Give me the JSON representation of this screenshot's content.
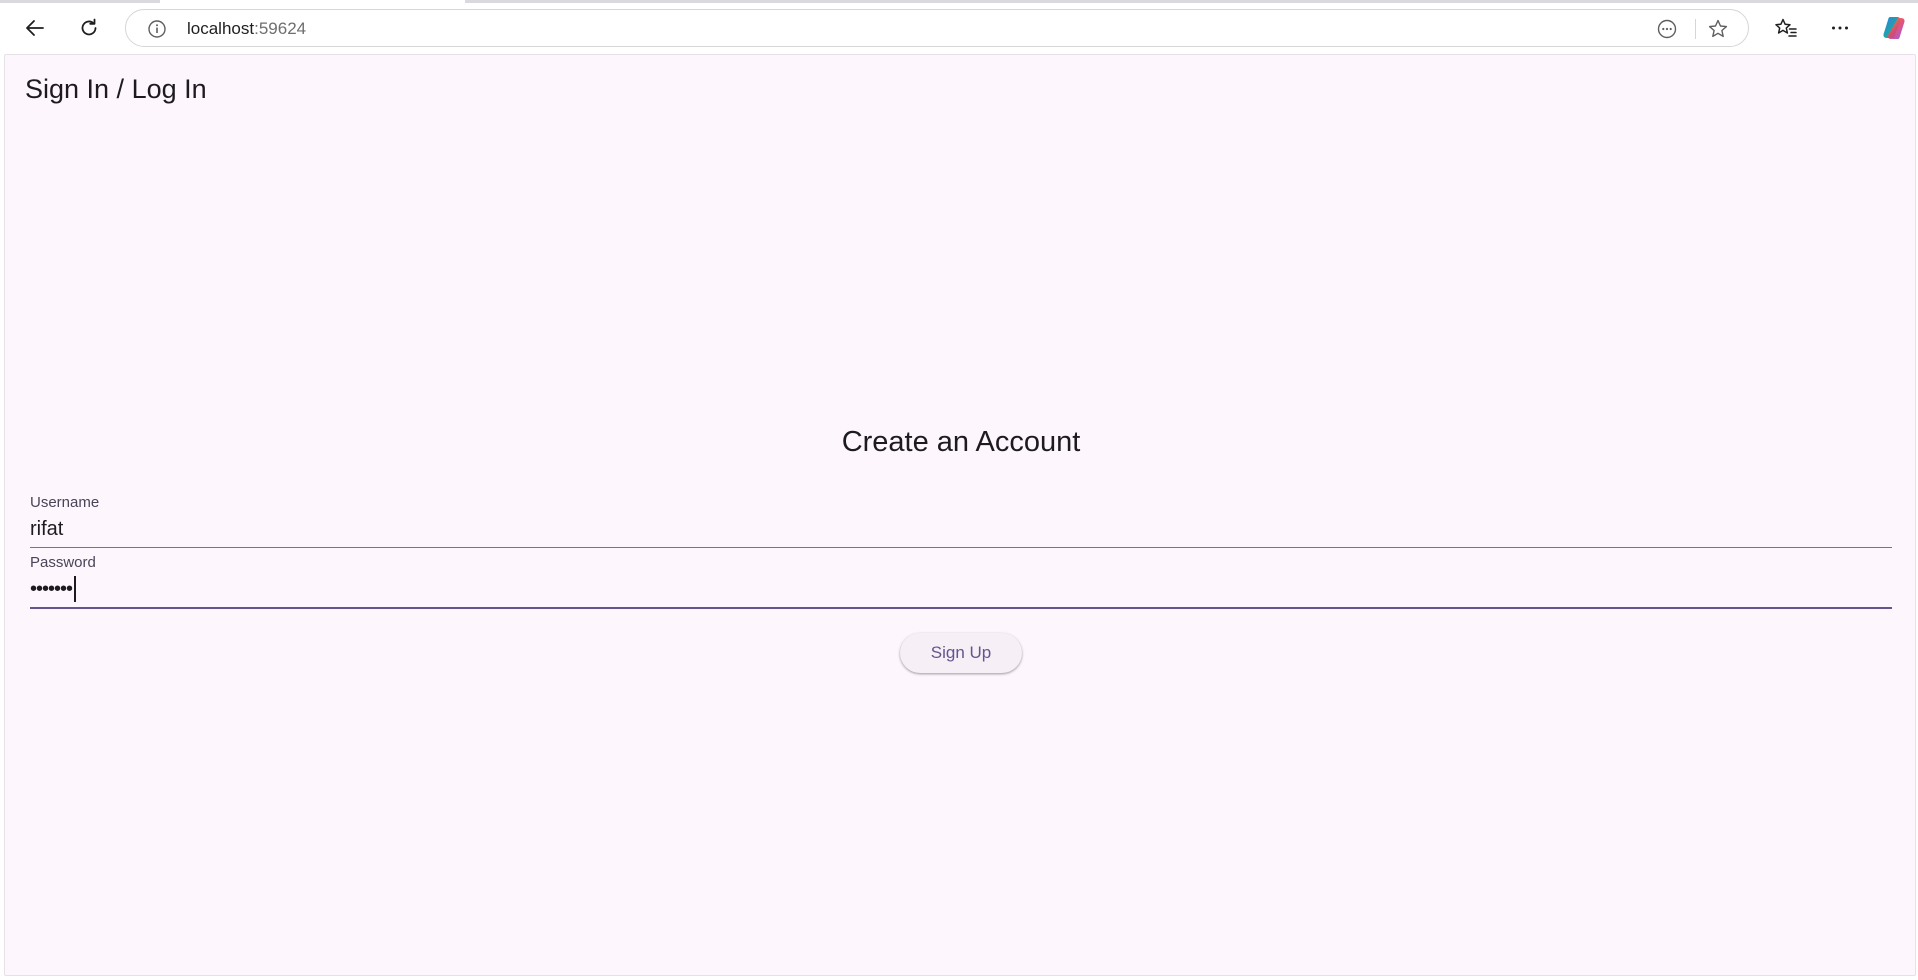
{
  "browser": {
    "url_host": "localhost",
    "url_port": ":59624"
  },
  "app": {
    "title": "Sign In / Log In",
    "heading": "Create an Account",
    "username": {
      "label": "Username",
      "value": "rifat"
    },
    "password": {
      "label": "Password",
      "masked_value": "•••••••"
    },
    "submit_label": "Sign Up"
  },
  "colors": {
    "page_background": "#fdf6fd",
    "accent": "#65558f",
    "text": "#1d1b20",
    "label": "#4a4458"
  }
}
